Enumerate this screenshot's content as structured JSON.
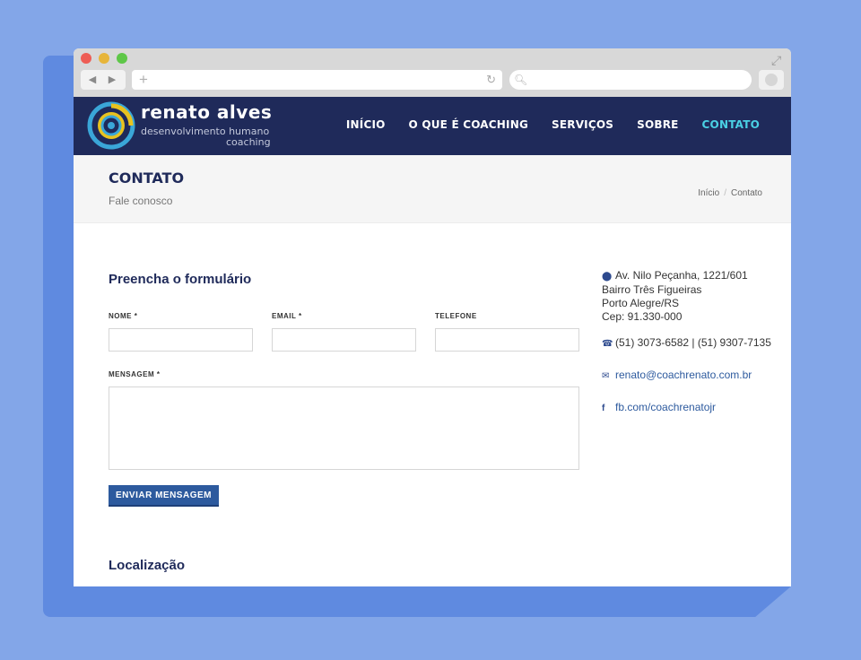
{
  "browser": {
    "icons": {
      "close": "red-dot",
      "minimize": "yellow-dot",
      "maximize": "green-dot",
      "back": "back-arrow-icon",
      "forward": "forward-arrow-icon",
      "new_tab": "plus-icon",
      "reload": "reload-icon",
      "search": "search-icon",
      "fullscreen": "expand-icon"
    },
    "url_value": "",
    "search_value": ""
  },
  "header": {
    "brand_name": "renato alves",
    "brand_sub1": "desenvolvimento humano",
    "brand_sub2": "coaching",
    "logo_icon": "target-logo",
    "menu": [
      {
        "label": "INÍCIO",
        "active": false
      },
      {
        "label": "O QUE É COACHING",
        "active": false
      },
      {
        "label": "SERVIÇOS",
        "active": false
      },
      {
        "label": "SOBRE",
        "active": false
      },
      {
        "label": "CONTATO",
        "active": true
      }
    ],
    "colors": {
      "background": "#1f2a5a",
      "active": "#4ad0e4"
    }
  },
  "titlebar": {
    "title": "CONTATO",
    "subtitle": "Fale conosco",
    "breadcrumb": [
      "Início",
      "Contato"
    ]
  },
  "form": {
    "heading": "Preencha o formulário",
    "name_label": "NOME *",
    "email_label": "EMAIL *",
    "phone_label": "TELEFONE",
    "message_label": "MENSAGEM *",
    "name_value": "",
    "email_value": "",
    "phone_value": "",
    "message_value": "",
    "submit_label": "ENVIAR MENSAGEM"
  },
  "contact": {
    "address": [
      "Av. Nilo Peçanha, 1221/601",
      "Bairro Três Figueiras",
      "Porto Alegre/RS",
      "Cep: 91.330-000"
    ],
    "phone": "(51) 3073-6582 | (51) 9307-7135",
    "email": "renato@coachrenato.com.br",
    "facebook": "fb.com/coachrenatojr",
    "icons": {
      "address": "map-marker-icon",
      "phone": "phone-icon",
      "email": "envelope-icon",
      "facebook": "facebook-icon"
    }
  },
  "location_heading": "Localização"
}
